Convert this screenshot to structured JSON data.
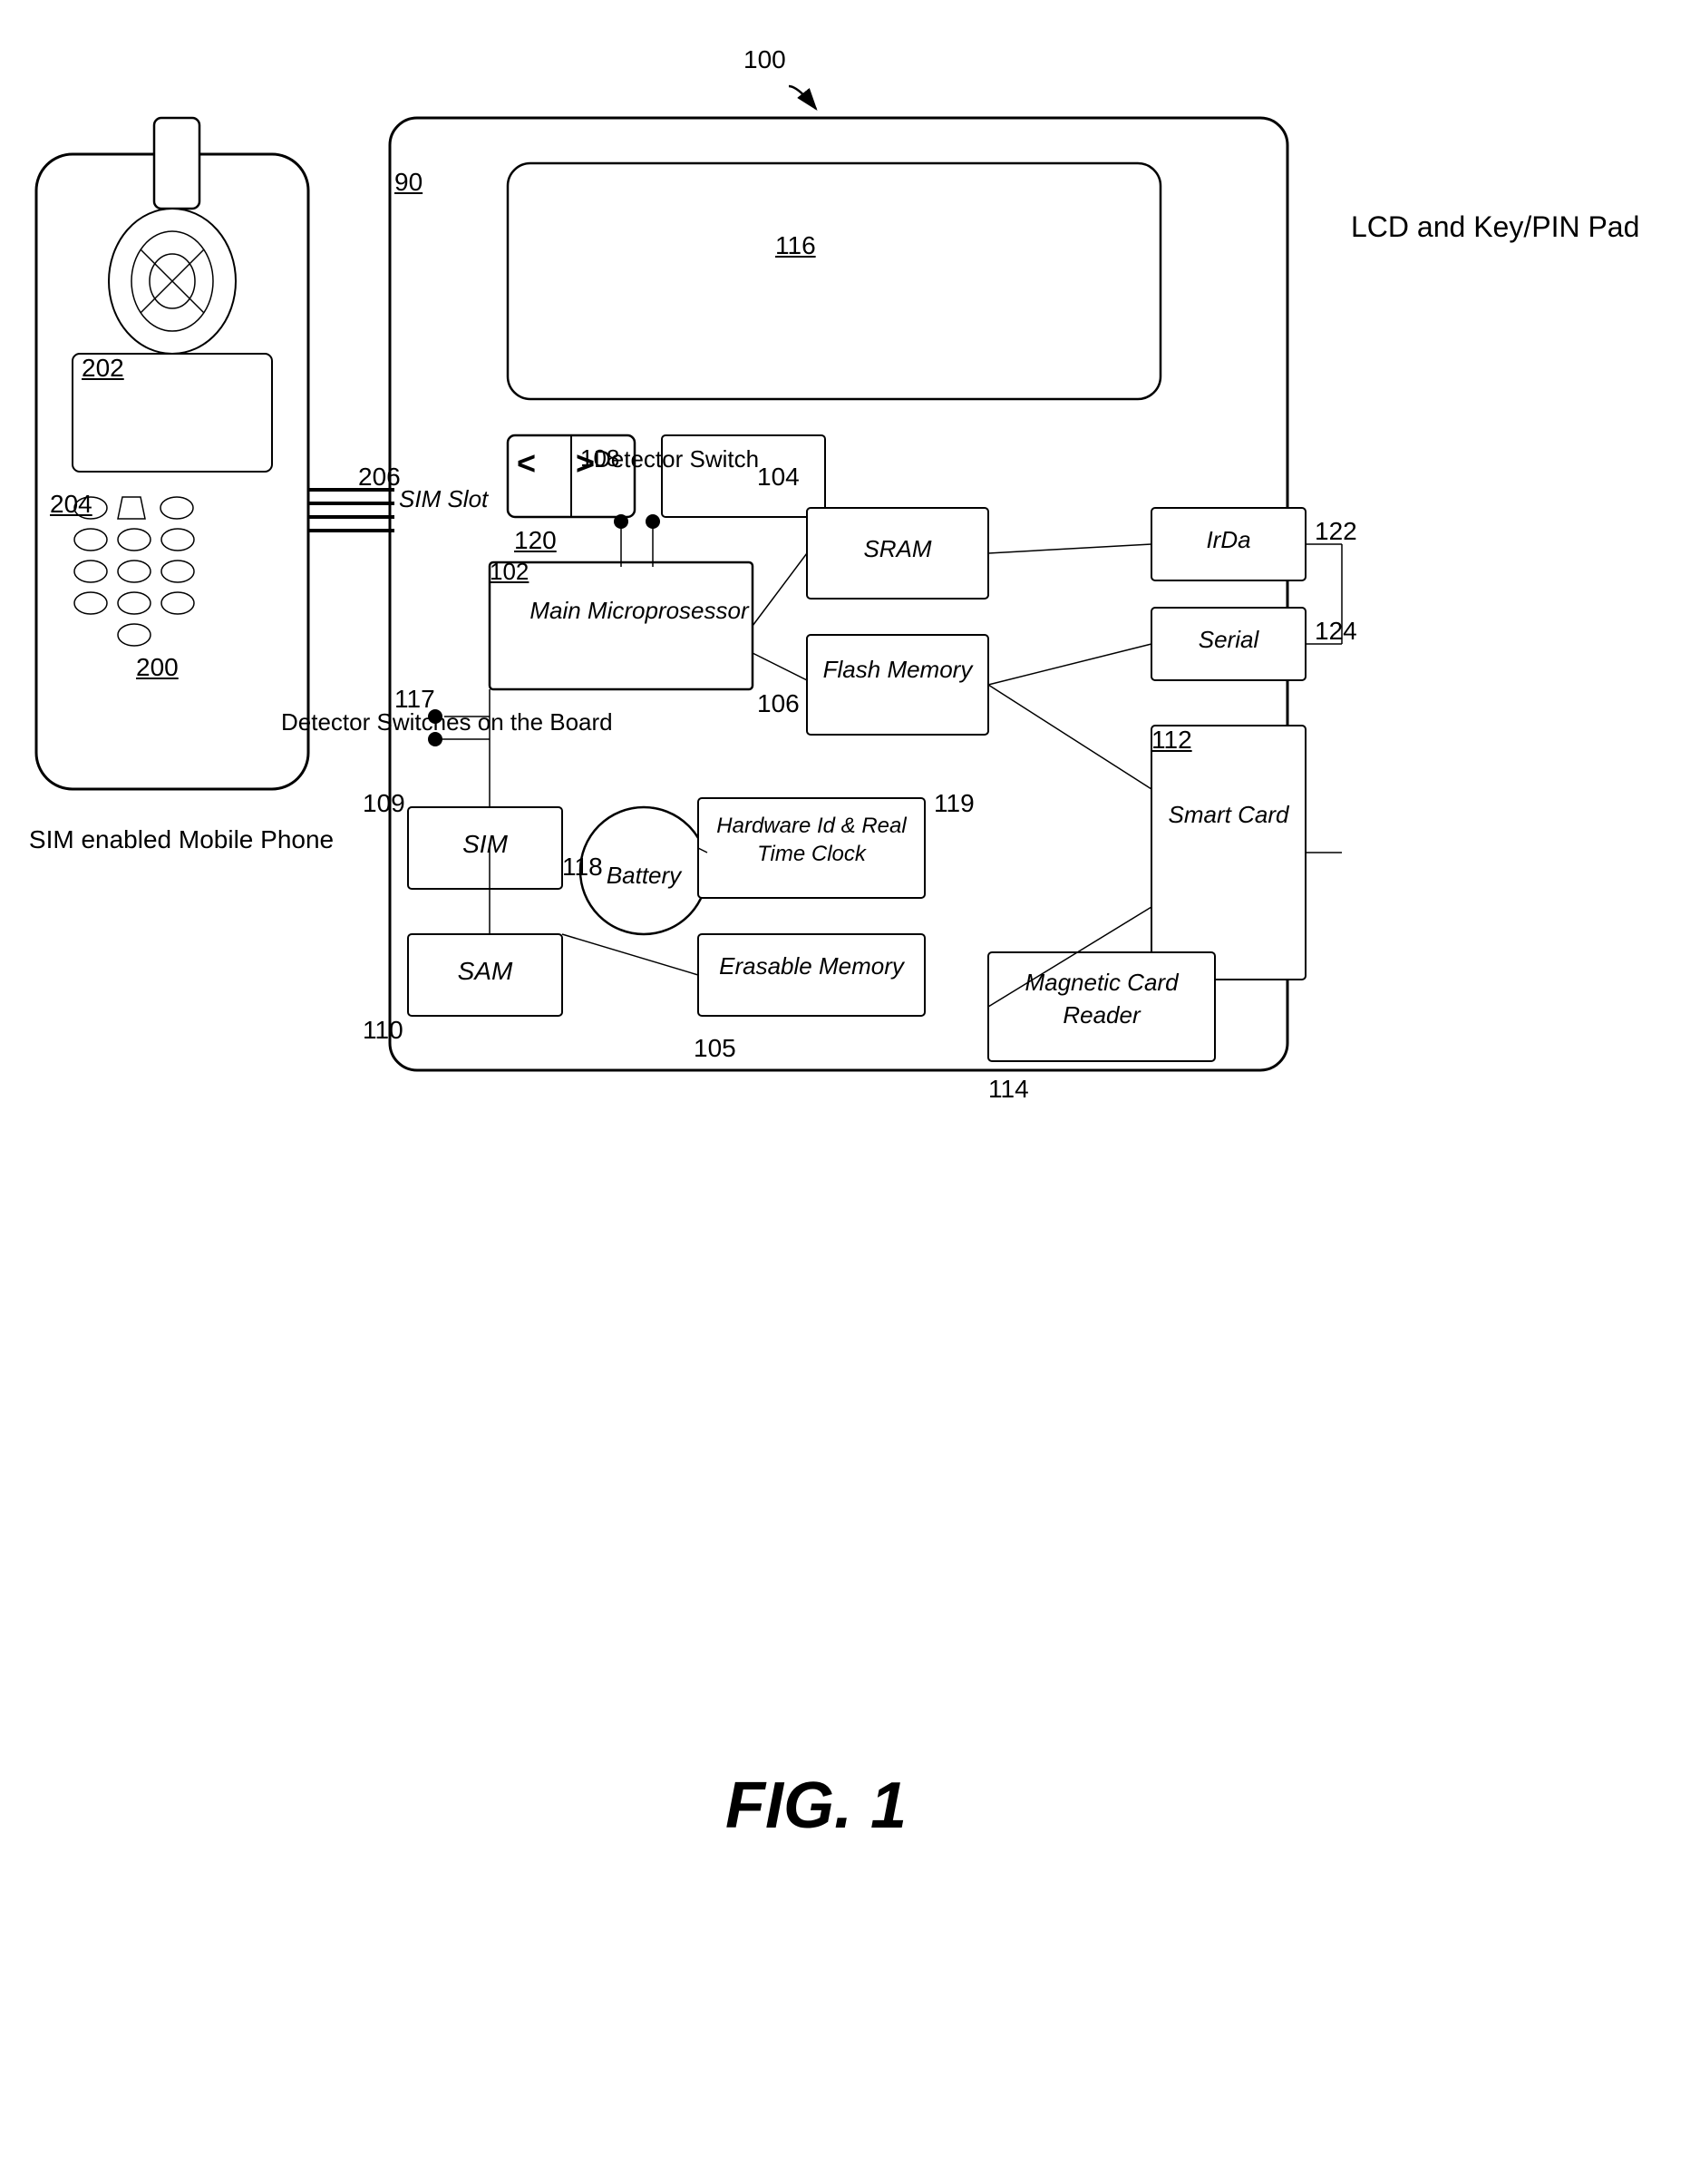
{
  "diagram": {
    "title": "FIG. 1",
    "ref_numbers": {
      "r100": "100",
      "r90": "90",
      "r116": "116",
      "r120": "120",
      "r102": "102",
      "r104": "104",
      "r106": "106",
      "r108": "108",
      "r109": "109",
      "r110": "110",
      "r112": "112",
      "r114": "114",
      "r117": "117",
      "r118": "118",
      "r119": "119",
      "r105": "105",
      "r122": "122",
      "r124": "124",
      "r200": "200",
      "r202": "202",
      "r204": "204",
      "r206": "206"
    },
    "components": {
      "main_microprosessor": "Main\nMicroprosessor",
      "sram": "SRAM",
      "flash_memory": "Flash\nMemory",
      "battery": "Battery",
      "sim_slot_label": "SIM Slot",
      "sim": "SIM",
      "sam": "SAM",
      "hardware_id": "Hardware Id &\nReal Time Clock",
      "erasable_memory": "Erasable Memory",
      "irda": "IrDa",
      "serial": "Serial",
      "smart_card": "Smart\nCard",
      "magnetic_card_reader": "Magnetic Card\nReader",
      "lcd_keypinpad": "LCD and\nKey/PIN Pad",
      "detector_switch": "Detector\nSwitch",
      "detector_switches_board": "Detector\nSwitches on the\nBoard"
    },
    "captions": {
      "sim_phone": "SIM enabled Mobile Phone"
    },
    "fig_label": "FIG. 1"
  }
}
